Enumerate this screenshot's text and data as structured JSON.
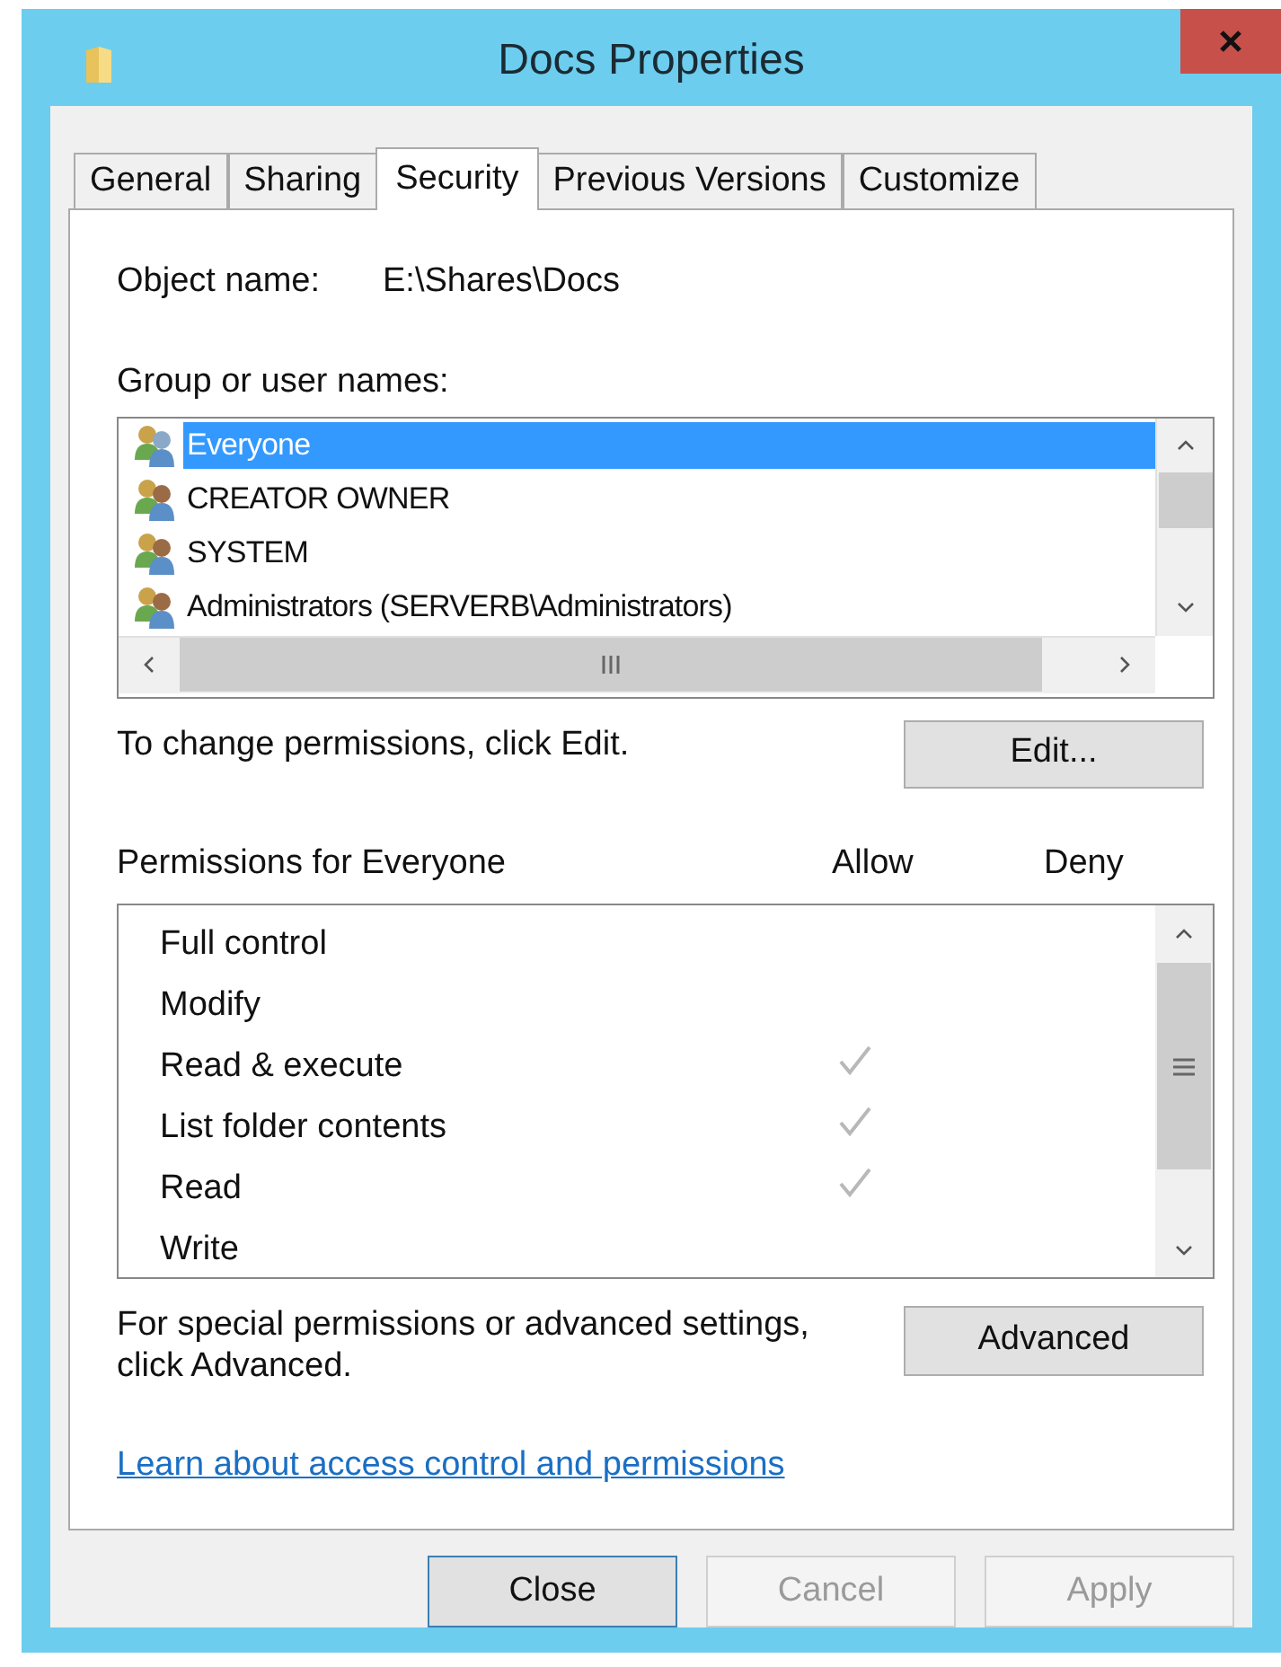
{
  "window": {
    "title": "Docs Properties"
  },
  "tabs": [
    {
      "label": "General",
      "selected": false
    },
    {
      "label": "Sharing",
      "selected": false
    },
    {
      "label": "Security",
      "selected": true
    },
    {
      "label": "Previous Versions",
      "selected": false
    },
    {
      "label": "Customize",
      "selected": false
    }
  ],
  "object_name": {
    "label": "Object name:",
    "value": "E:\\Shares\\Docs"
  },
  "group_label": "Group or user names:",
  "users": [
    {
      "name": "Everyone",
      "selected": true
    },
    {
      "name": "CREATOR OWNER",
      "selected": false
    },
    {
      "name": "SYSTEM",
      "selected": false
    },
    {
      "name": "Administrators (SERVERB\\Administrators)",
      "selected": false
    }
  ],
  "change_hint": "To change permissions, click Edit.",
  "edit_button": "Edit...",
  "permissions": {
    "title": "Permissions for Everyone",
    "allow_header": "Allow",
    "deny_header": "Deny",
    "rows": [
      {
        "name": "Full control",
        "allow": false,
        "deny": false
      },
      {
        "name": "Modify",
        "allow": false,
        "deny": false
      },
      {
        "name": "Read & execute",
        "allow": true,
        "deny": false
      },
      {
        "name": "List folder contents",
        "allow": true,
        "deny": false
      },
      {
        "name": "Read",
        "allow": true,
        "deny": false
      },
      {
        "name": "Write",
        "allow": false,
        "deny": false
      }
    ]
  },
  "advanced_hint": "For special permissions or advanced settings, click Advanced.",
  "advanced_button": "Advanced",
  "link": "Learn about access control and permissions",
  "buttons": [
    {
      "label": "Close",
      "disabled": false,
      "default": true
    },
    {
      "label": "Cancel",
      "disabled": true,
      "default": false
    },
    {
      "label": "Apply",
      "disabled": true,
      "default": false
    }
  ]
}
